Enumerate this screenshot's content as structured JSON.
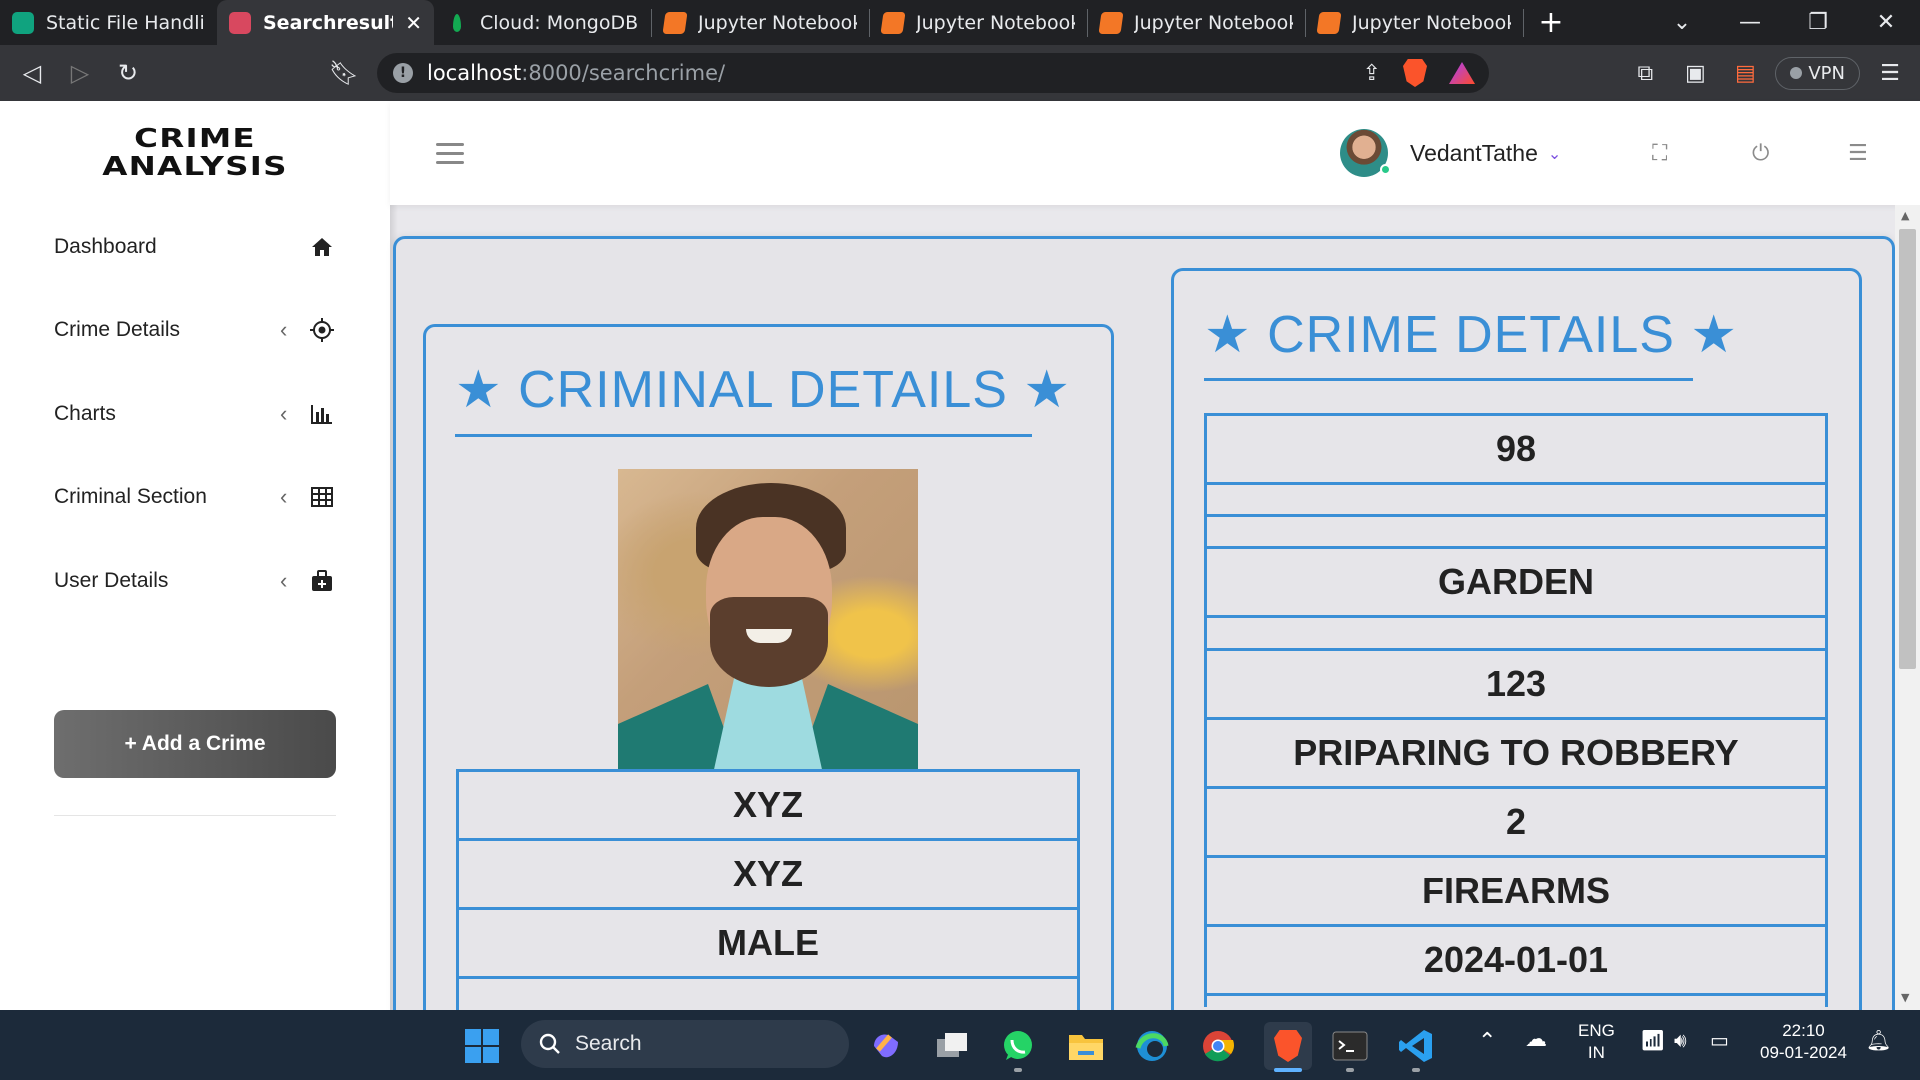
{
  "browser": {
    "tabs": [
      {
        "title": "Static File Handling i",
        "favicon": "chatgpt-icon",
        "active": false
      },
      {
        "title": "Searchresult",
        "favicon": "search-result-icon",
        "active": true
      },
      {
        "title": "Cloud: MongoDB Cl",
        "favicon": "mongodb-leaf-icon",
        "active": false
      },
      {
        "title": "Jupyter Notebook",
        "favicon": "jupyter-icon",
        "active": false
      },
      {
        "title": "Jupyter Notebook",
        "favicon": "jupyter-icon",
        "active": false
      },
      {
        "title": "Jupyter Notebook",
        "favicon": "jupyter-icon",
        "active": false
      },
      {
        "title": "Jupyter Notebook",
        "favicon": "jupyter-icon",
        "active": false
      }
    ],
    "url_host": "localhost",
    "url_rest": ":8000/searchcrime/",
    "rewards_badge": "1",
    "vpn_label": "VPN"
  },
  "sidebar": {
    "brand_line1": "CRIME",
    "brand_line2": "ANALYSIS",
    "items": [
      {
        "label": "Dashboard",
        "icon": "home-icon",
        "has_chevron": false
      },
      {
        "label": "Crime Details",
        "icon": "crosshair-icon",
        "has_chevron": true
      },
      {
        "label": "Charts",
        "icon": "bar-chart-icon",
        "has_chevron": true
      },
      {
        "label": "Criminal Section",
        "icon": "table-grid-icon",
        "has_chevron": true
      },
      {
        "label": "User Details",
        "icon": "user-case-icon",
        "has_chevron": true
      }
    ],
    "add_button": "+ Add a Crime"
  },
  "header": {
    "username": "VedantTathe"
  },
  "criminal_card": {
    "title": "★ CRIMINAL DETAILS ★",
    "rows": [
      "XYZ",
      "XYZ",
      "MALE",
      ""
    ]
  },
  "crime_card": {
    "title": "★ CRIME DETAILS ★",
    "rows": [
      "98",
      "",
      "",
      "GARDEN",
      "",
      "123",
      "PRIPARING TO ROBBERY",
      "2",
      "FIREARMS",
      "2024-01-01"
    ]
  },
  "taskbar": {
    "search_placeholder": "Search",
    "lang_line1": "ENG",
    "lang_line2": "IN",
    "time": "22:10",
    "date": "09-01-2024"
  },
  "colors": {
    "accent": "#3a8fd6",
    "tab_strip": "#202124",
    "taskbar": "#1c2a3a"
  }
}
